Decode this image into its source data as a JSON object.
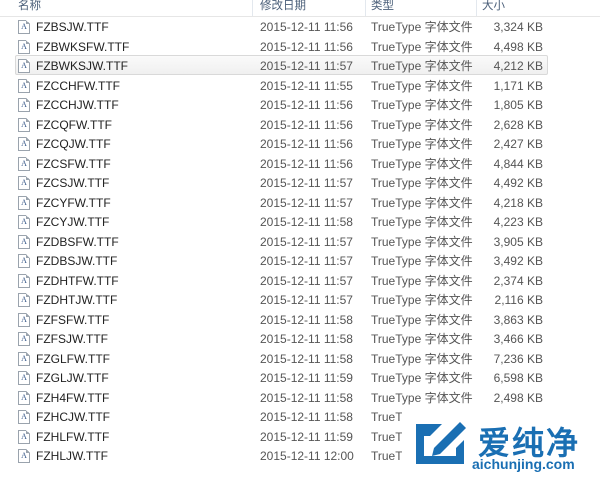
{
  "columns": {
    "name": "名称",
    "date": "修改日期",
    "type": "类型",
    "size": "大小"
  },
  "icon": "font-file-icon",
  "selected_index": 2,
  "files": [
    {
      "name": "FZBSJW.TTF",
      "date": "2015-12-11 11:56",
      "type": "TrueType 字体文件",
      "size": "3,324 KB"
    },
    {
      "name": "FZBWKSFW.TTF",
      "date": "2015-12-11 11:56",
      "type": "TrueType 字体文件",
      "size": "4,498 KB"
    },
    {
      "name": "FZBWKSJW.TTF",
      "date": "2015-12-11 11:57",
      "type": "TrueType 字体文件",
      "size": "4,212 KB"
    },
    {
      "name": "FZCCHFW.TTF",
      "date": "2015-12-11 11:55",
      "type": "TrueType 字体文件",
      "size": "1,171 KB"
    },
    {
      "name": "FZCCHJW.TTF",
      "date": "2015-12-11 11:56",
      "type": "TrueType 字体文件",
      "size": "1,805 KB"
    },
    {
      "name": "FZCQFW.TTF",
      "date": "2015-12-11 11:56",
      "type": "TrueType 字体文件",
      "size": "2,628 KB"
    },
    {
      "name": "FZCQJW.TTF",
      "date": "2015-12-11 11:56",
      "type": "TrueType 字体文件",
      "size": "2,427 KB"
    },
    {
      "name": "FZCSFW.TTF",
      "date": "2015-12-11 11:56",
      "type": "TrueType 字体文件",
      "size": "4,844 KB"
    },
    {
      "name": "FZCSJW.TTF",
      "date": "2015-12-11 11:57",
      "type": "TrueType 字体文件",
      "size": "4,492 KB"
    },
    {
      "name": "FZCYFW.TTF",
      "date": "2015-12-11 11:57",
      "type": "TrueType 字体文件",
      "size": "4,218 KB"
    },
    {
      "name": "FZCYJW.TTF",
      "date": "2015-12-11 11:58",
      "type": "TrueType 字体文件",
      "size": "4,223 KB"
    },
    {
      "name": "FZDBSFW.TTF",
      "date": "2015-12-11 11:57",
      "type": "TrueType 字体文件",
      "size": "3,905 KB"
    },
    {
      "name": "FZDBSJW.TTF",
      "date": "2015-12-11 11:57",
      "type": "TrueType 字体文件",
      "size": "3,492 KB"
    },
    {
      "name": "FZDHTFW.TTF",
      "date": "2015-12-11 11:57",
      "type": "TrueType 字体文件",
      "size": "2,374 KB"
    },
    {
      "name": "FZDHTJW.TTF",
      "date": "2015-12-11 11:57",
      "type": "TrueType 字体文件",
      "size": "2,116 KB"
    },
    {
      "name": "FZFSFW.TTF",
      "date": "2015-12-11 11:58",
      "type": "TrueType 字体文件",
      "size": "3,863 KB"
    },
    {
      "name": "FZFSJW.TTF",
      "date": "2015-12-11 11:58",
      "type": "TrueType 字体文件",
      "size": "3,466 KB"
    },
    {
      "name": "FZGLFW.TTF",
      "date": "2015-12-11 11:58",
      "type": "TrueType 字体文件",
      "size": "7,236 KB"
    },
    {
      "name": "FZGLJW.TTF",
      "date": "2015-12-11 11:59",
      "type": "TrueType 字体文件",
      "size": "6,598 KB"
    },
    {
      "name": "FZH4FW.TTF",
      "date": "2015-12-11 11:58",
      "type": "TrueType 字体文件",
      "size": "2,498 KB"
    },
    {
      "name": "FZHCJW.TTF",
      "date": "2015-12-11 11:58",
      "type": "TrueT",
      "size": ""
    },
    {
      "name": "FZHLFW.TTF",
      "date": "2015-12-11 11:59",
      "type": "TrueT",
      "size": ""
    },
    {
      "name": "FZHLJW.TTF",
      "date": "2015-12-11 12:00",
      "type": "TrueT",
      "size": ""
    }
  ],
  "watermark": {
    "cn": "爱纯净",
    "url": "aichunjing.com",
    "color": "#1a6fb3"
  }
}
